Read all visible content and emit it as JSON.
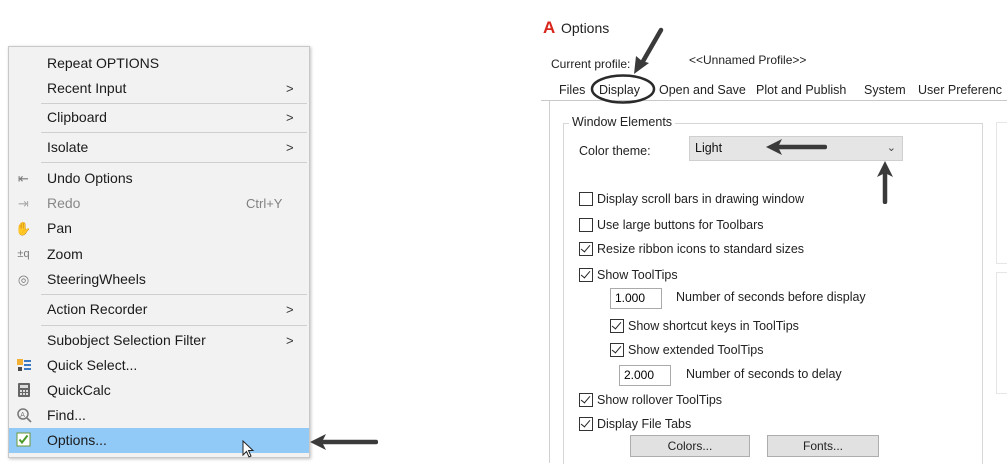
{
  "context_menu": {
    "items": [
      {
        "label": "Repeat OPTIONS",
        "shortcut": "",
        "submenu": false,
        "icon": ""
      },
      {
        "label": "Recent Input",
        "shortcut": "",
        "submenu": true,
        "icon": ""
      },
      {
        "label": "Clipboard",
        "shortcut": "",
        "submenu": true,
        "icon": ""
      },
      {
        "label": "Isolate",
        "shortcut": "",
        "submenu": true,
        "icon": ""
      },
      {
        "label": "Undo Options",
        "shortcut": "",
        "submenu": false,
        "icon": "undo-icon"
      },
      {
        "label": "Redo",
        "shortcut": "Ctrl+Y",
        "submenu": false,
        "icon": "redo-icon"
      },
      {
        "label": "Pan",
        "shortcut": "",
        "submenu": false,
        "icon": "pan-hand-icon"
      },
      {
        "label": "Zoom",
        "shortcut": "",
        "submenu": false,
        "icon": "zoom-icon"
      },
      {
        "label": "SteeringWheels",
        "shortcut": "",
        "submenu": false,
        "icon": "steering-wheel-icon"
      },
      {
        "label": "Action Recorder",
        "shortcut": "",
        "submenu": true,
        "icon": ""
      },
      {
        "label": "Subobject Selection Filter",
        "shortcut": "",
        "submenu": true,
        "icon": ""
      },
      {
        "label": "Quick Select...",
        "shortcut": "",
        "submenu": false,
        "icon": "quick-select-icon"
      },
      {
        "label": "QuickCalc",
        "shortcut": "",
        "submenu": false,
        "icon": "calculator-icon"
      },
      {
        "label": "Find...",
        "shortcut": "",
        "submenu": false,
        "icon": "find-icon"
      },
      {
        "label": "Options...",
        "shortcut": "",
        "submenu": false,
        "icon": "options-check-icon"
      }
    ],
    "submenu_glyph": ">",
    "highlight_color": "#91c9f7"
  },
  "dialog": {
    "logo": "A",
    "title": "Options",
    "profile_label": "Current profile:",
    "profile_value": "<<Unnamed Profile>>",
    "tabs": [
      "Files",
      "Display",
      "Open and Save",
      "Plot and Publish",
      "System",
      "User Preferenc"
    ],
    "active_tab": "Display",
    "window_elements": {
      "group_label": "Window Elements",
      "color_theme_label": "Color theme:",
      "color_theme_value": "Light",
      "options": [
        {
          "label": "Display scroll bars in drawing window",
          "checked": false
        },
        {
          "label": "Use large buttons for Toolbars",
          "checked": false
        },
        {
          "label": "Resize ribbon icons to standard sizes",
          "checked": true
        },
        {
          "label": "Show ToolTips",
          "checked": true
        }
      ],
      "tooltip_delay_value": "1.000",
      "tooltip_delay_label": "Number of seconds before display",
      "show_shortcut_keys": {
        "label": "Show shortcut keys in ToolTips",
        "checked": true
      },
      "show_extended": {
        "label": "Show extended ToolTips",
        "checked": true
      },
      "extended_delay_value": "2.000",
      "extended_delay_label": "Number of seconds to delay",
      "show_rollover": {
        "label": "Show rollover ToolTips",
        "checked": true
      },
      "display_file_tabs": {
        "label": "Display File Tabs",
        "checked": true
      },
      "colors_button": "Colors...",
      "fonts_button": "Fonts..."
    }
  },
  "colors": {
    "accent_red": "#d9261c",
    "annotation": "#3a3a3a"
  }
}
